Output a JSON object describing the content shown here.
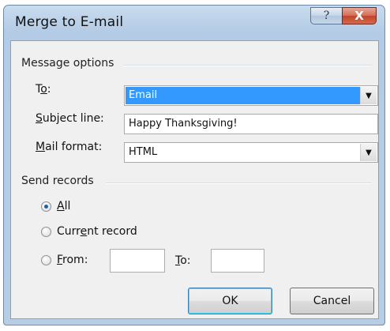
{
  "window": {
    "title": "Merge to E-mail",
    "help_glyph": "?",
    "close_glyph": "X"
  },
  "message_options": {
    "group_label": "Message options",
    "to_label_pre": "T",
    "to_label_ul": "o",
    "to_label_post": ":",
    "to_value": "Email",
    "subject_label_ul": "S",
    "subject_label_post": "ubject line:",
    "subject_value": "Happy Thanksgiving!",
    "format_label_ul": "M",
    "format_label_post": "ail format:",
    "format_value": "HTML"
  },
  "send_records": {
    "group_label": "Send records",
    "all_label_ul": "A",
    "all_label_post": "ll",
    "current_label_pre": "Curr",
    "current_label_ul": "e",
    "current_label_post": "nt record",
    "from_label_ul": "F",
    "from_label_post": "rom:",
    "from_value": "",
    "to_label_ul": "T",
    "to_label_post": "o:",
    "to_value": "",
    "selected": "All"
  },
  "buttons": {
    "ok": "OK",
    "cancel": "Cancel"
  },
  "icons": {
    "help": "help-icon",
    "close": "close-icon",
    "dropdown": "chevron-down-icon"
  },
  "colors": {
    "selection": "#3399ff",
    "close_button": "#c1432a",
    "frame": "#b7cde4"
  }
}
